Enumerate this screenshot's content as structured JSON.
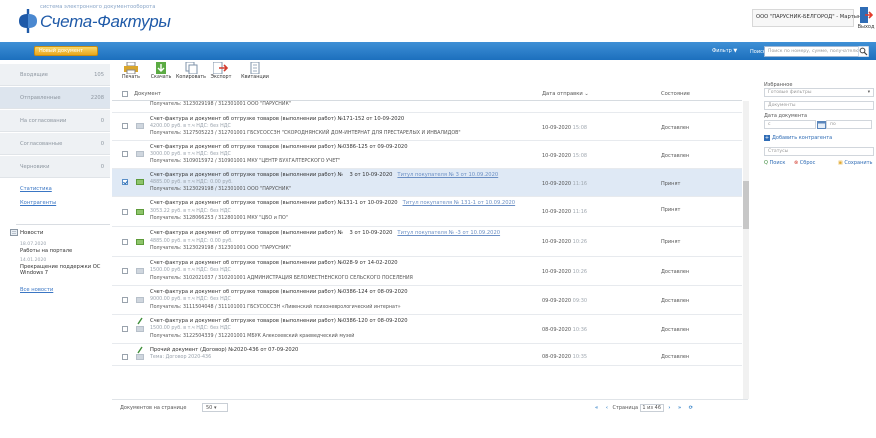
{
  "header": {
    "logo_small": "система электронного документооборота",
    "logo_title": "Счета-Фактуры",
    "account": "ООО \"ПАРУСНИК-БЕЛГОРОД\" - Мартын...",
    "logout": "Выход"
  },
  "bluebar": {
    "new_document": "Новый документ",
    "filter": "Фильтр ▼",
    "search_label": "Поиск",
    "search_placeholder": "Поиск по номеру, сумме, получателю"
  },
  "sidebar": {
    "items": [
      {
        "label": "Входящие",
        "count": "105"
      },
      {
        "label": "Отправленные",
        "count": "2208"
      },
      {
        "label": "На согласовании",
        "count": "0"
      },
      {
        "label": "Согласованные",
        "count": "0"
      },
      {
        "label": "Черновики",
        "count": "0"
      }
    ],
    "links": [
      "Статистика",
      "Контрагенты"
    ],
    "news": {
      "heading": "Новости",
      "items": [
        {
          "date": "18.07.2020",
          "title": "Работы на портале"
        },
        {
          "date": "14.01.2020",
          "title": "Прекращение поддержки ОС Windows 7"
        }
      ],
      "all": "Все новости"
    }
  },
  "toolbar": {
    "buttons": [
      "Печать",
      "Скачать",
      "Копировать",
      "Экспорт",
      "Квитанции"
    ]
  },
  "table": {
    "columns": {
      "doc": "Документ",
      "date": "Дата отправки",
      "status": "Состояние"
    },
    "rows": [
      {
        "l1": "",
        "l2": "",
        "l3": "Получатель: 3123029198 / 312301001 ООО \"ПАРУСНИК\"",
        "date": "",
        "time": "",
        "status": ""
      },
      {
        "l1": "Счет-фактура и документ об отгрузке товаров (выполнении работ) №171-152 от 10-09-2020",
        "l1b": "",
        "l1c": "",
        "l2": "4200.00 руб. в т.ч НДС: без НДС",
        "l3": "Получатель: 3127505223 / 312701001 ГБСУСОССЗН \"СКОРОДНЯНСКИЙ ДОМ-ИНТЕРНАТ ДЛЯ ПРЕСТАРЕЛЫХ И ИНВАЛИДОВ\"",
        "date": "10-09-2020",
        "time": "15:08",
        "status": "Доставлен"
      },
      {
        "l1": "Счет-фактура и документ об отгрузке товаров (выполнении работ) №0386-125 от 09-09-2020",
        "l1b": "",
        "l1c": "",
        "l2": "3000.00 руб. в т.ч НДС: без НДС",
        "l3": "Получатель: 3109015972 / 310901001 МКУ \"ЦЕНТР БУХГАЛТЕРСКОГО УЧЕТ\"",
        "date": "10-09-2020",
        "time": "15:08",
        "status": "Доставлен"
      },
      {
        "l1": "Счет-фактура и документ об отгрузке товаров (выполнении работ) №",
        "l1b": "3 от 10-09-2020",
        "l1c": "Титул покупателя № 3 от 10.09.2020",
        "l2": "4885.00 руб. в т.ч НДС: 0.00 руб.",
        "l3": "Получатель: 3123029198 / 312301001 ООО \"ПАРУСНИК\"",
        "date": "10-09-2020",
        "time": "11:16",
        "status": "Принят"
      },
      {
        "l1": "Счет-фактура и документ об отгрузке товаров (выполнении работ) №131-1 от 10-09-2020",
        "l1b": "",
        "l1c": "Титул покупателя № 131-1 от 10.09.2020",
        "l2": "3053.22 руб. в т.ч НДС: без НДС",
        "l3": "Получатель: 3128066253 / 312801001 МКУ \"ЦБО и ПО\"",
        "date": "10-09-2020",
        "time": "11:16",
        "status": "Принят"
      },
      {
        "l1": "Счет-фактура и документ об отгрузке товаров (выполнении работ) №",
        "l1b": "3 от 10-09-2020",
        "l1c": "Титул покупателя № -3 от 10.09.2020",
        "l2": "4885.00 руб. в т.ч НДС: 0.00 руб.",
        "l3": "Получатель: 3123029198 / 312301001 ООО \"ПАРУСНИК\"",
        "date": "10-09-2020",
        "time": "10:26",
        "status": "Принят"
      },
      {
        "l1": "Счет-фактура и документ об отгрузке товаров (выполнении работ) №028-9 от 14-02-2020",
        "l1b": "",
        "l1c": "",
        "l2": "1500.00 руб. в т.ч НДС: без НДС",
        "l3": "Получатель: 3102021037 / 310201001 АДМИНИСТРАЦИЯ БЕЛОМЕСТНЕНСКОГО СЕЛЬСКОГО ПОСЕЛЕНИЯ",
        "date": "10-09-2020",
        "time": "10:26",
        "status": "Доставлен"
      },
      {
        "l1": "Счет-фактура и документ об отгрузке товаров (выполнении работ) №0386-124 от 08-09-2020",
        "l1b": "",
        "l1c": "",
        "l2": "9000.00 руб. в т.ч НДС: без НДС",
        "l3": "Получатель: 3111504048 / 311101001 ГБСУСОССЗН «Ливенский психоневрологический интернат»",
        "date": "09-09-2020",
        "time": "09:30",
        "status": "Доставлен"
      },
      {
        "l1": "Счет-фактура и документ об отгрузке товаров (выполнении работ) №0386-120 от 08-09-2020",
        "l1b": "",
        "l1c": "",
        "l2": "1500.00 руб. в т.ч НДС: без НДС",
        "l3": "Получатель: 3122504339 / 312201001 МБУК Алексеевский краеведческий музей",
        "date": "08-09-2020",
        "time": "10:36",
        "status": "Доставлен"
      },
      {
        "l1": "Прочий документ (Договор) №2020-436 от 07-09-2020",
        "l1b": "",
        "l1c": "",
        "l2": "Тема: Договор 2020-436",
        "l3": "",
        "date": "08-09-2020",
        "time": "10:35",
        "status": "Доставлен"
      }
    ]
  },
  "footer": {
    "per_page_label": "Документов на странице",
    "per_page_value": "50",
    "page_label": "Страница",
    "page_value": "1 из 46"
  },
  "right_panel": {
    "selected_label": "Избранное",
    "ready_filters": "Готовые фильтры",
    "documents": "Документы",
    "doc_date_label": "Дата документа",
    "date_from": "с",
    "date_to": "по",
    "add_counterparty": "Добавить контрагента",
    "status_field": "Статусы",
    "search_btn": "Поиск",
    "reset_btn": "Сброс",
    "save_btn": "Сохранить"
  }
}
